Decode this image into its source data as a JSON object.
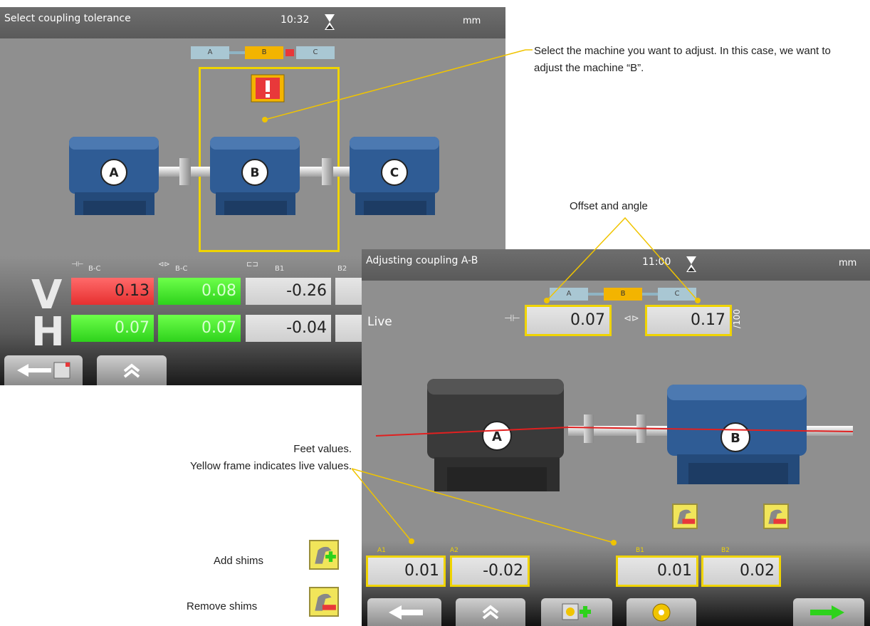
{
  "screen1": {
    "title": "Select coupling tolerance",
    "time": "10:32",
    "unit": "mm",
    "minimap": [
      "A",
      "B",
      "C"
    ],
    "machines": [
      "A",
      "B",
      "C"
    ],
    "col_labels": [
      "B-C",
      "B-C",
      "B1",
      "B2"
    ],
    "rows": [
      {
        "label": "V",
        "values": [
          "0.13",
          "0.08",
          "-0.26"
        ]
      },
      {
        "label": "H",
        "values": [
          "0.07",
          "0.07",
          "-0.04"
        ]
      }
    ]
  },
  "screen2": {
    "title": "Adjusting coupling A-B",
    "time": "11:00",
    "unit": "mm",
    "minimap": [
      "A",
      "B",
      "C"
    ],
    "mode": "Live",
    "offset": "0.07",
    "angle": "0.17",
    "angle_unit": "/100",
    "machines": [
      "A",
      "B"
    ],
    "feet": [
      {
        "label": "A1",
        "value": "0.01"
      },
      {
        "label": "A2",
        "value": "-0.02"
      },
      {
        "label": "B1",
        "value": "0.01"
      },
      {
        "label": "B2",
        "value": "0.02"
      }
    ]
  },
  "annotations": {
    "select_machine": "Select the machine you want to adjust. In this case, we want to adjust the machine “B”.",
    "offset_angle": "Offset and angle",
    "feet_line1": "Feet values.",
    "feet_line2": "Yellow frame indicates live values.",
    "add_shims": "Add shims",
    "remove_shims": "Remove shims"
  },
  "colors": {
    "accent": "#f0c400",
    "machine_blue": "#2f5c95",
    "red": "#e8383a",
    "green": "#2ed21c"
  }
}
